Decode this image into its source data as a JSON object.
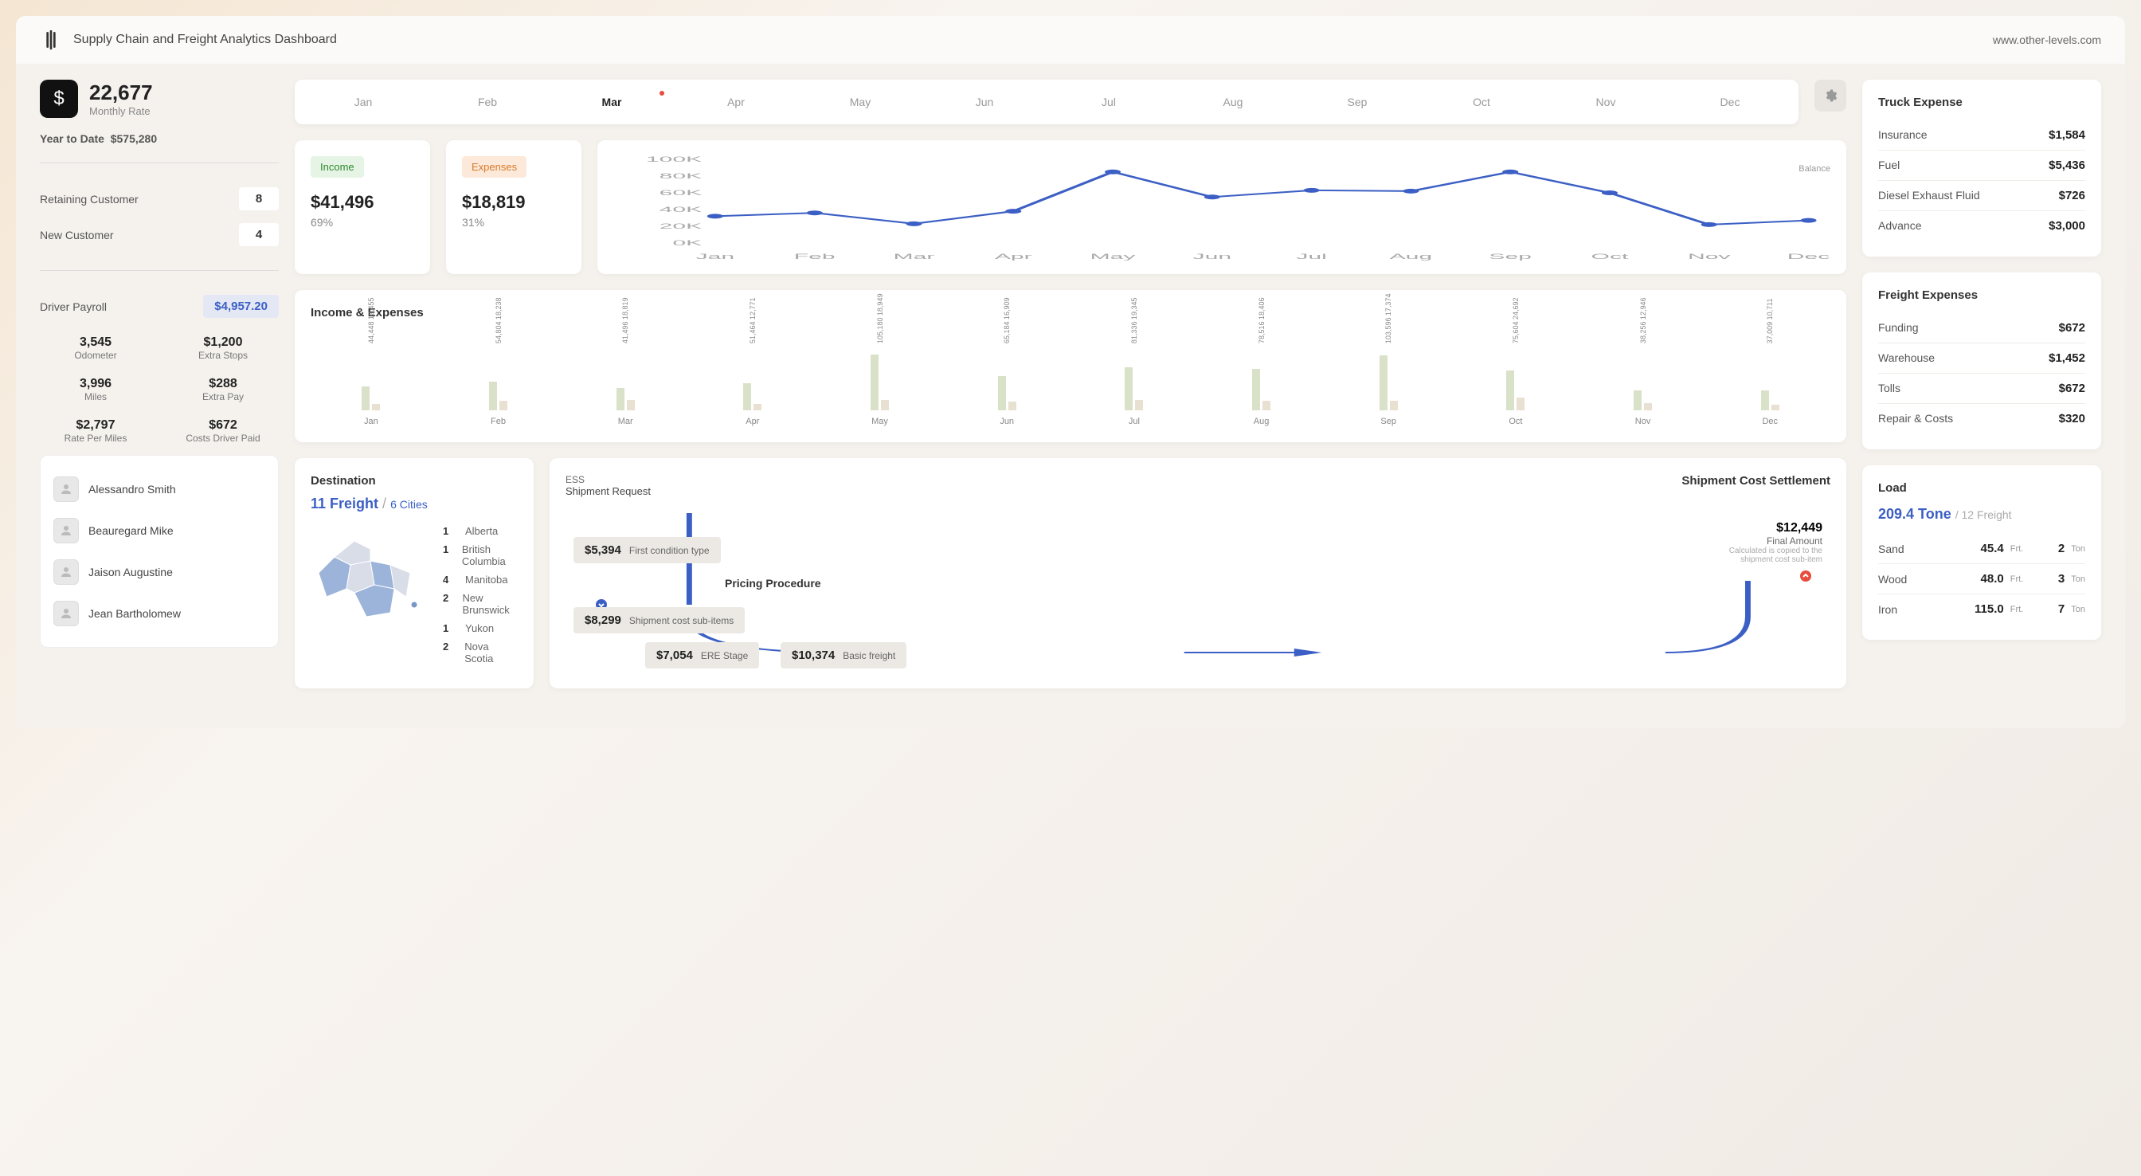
{
  "header": {
    "title": "Supply Chain and Freight Analytics Dashboard",
    "url": "www.other-levels.com"
  },
  "rate": {
    "value": "22,677",
    "label": "Monthly Rate",
    "ytd_label": "Year to Date",
    "ytd_value": "$575,280"
  },
  "customers": [
    {
      "label": "Retaining Customer",
      "value": "8"
    },
    {
      "label": "New Customer",
      "value": "4"
    }
  ],
  "payroll": {
    "label": "Driver Payroll",
    "value": "$4,957.20"
  },
  "stats": [
    {
      "v": "3,545",
      "l": "Odometer"
    },
    {
      "v": "$1,200",
      "l": "Extra Stops"
    },
    {
      "v": "3,996",
      "l": "Miles"
    },
    {
      "v": "$288",
      "l": "Extra Pay"
    },
    {
      "v": "$2,797",
      "l": "Rate Per Miles"
    },
    {
      "v": "$672",
      "l": "Costs Driver Paid"
    }
  ],
  "drivers": [
    "Alessandro Smith",
    "Beauregard Mike",
    "Jaison Augustine",
    "Jean Bartholomew"
  ],
  "months": [
    "Jan",
    "Feb",
    "Mar",
    "Apr",
    "May",
    "Jun",
    "Jul",
    "Aug",
    "Sep",
    "Oct",
    "Nov",
    "Dec"
  ],
  "active_month": "Mar",
  "income_card": {
    "badge": "Income",
    "value": "$41,496",
    "pct": "69%"
  },
  "expense_card": {
    "badge": "Expenses",
    "value": "$18,819",
    "pct": "31%"
  },
  "chart_data": {
    "type": "line",
    "title": "Balance",
    "ylabel": "",
    "xlabel": "",
    "ylim": [
      0,
      100000
    ],
    "yticks": [
      "0K",
      "20K",
      "40K",
      "60K",
      "80K",
      "100K"
    ],
    "categories": [
      "Jan",
      "Feb",
      "Mar",
      "Apr",
      "May",
      "Jun",
      "Jul",
      "Aug",
      "Sep",
      "Oct",
      "Nov",
      "Dec"
    ],
    "values": [
      32000,
      36000,
      23000,
      38000,
      85000,
      55000,
      63000,
      62000,
      85000,
      60000,
      22000,
      27000
    ]
  },
  "income_expenses": {
    "title": "Income & Expenses",
    "type": "bar",
    "categories": [
      "Jan",
      "Feb",
      "Mar",
      "Apr",
      "May",
      "Jun",
      "Jul",
      "Aug",
      "Sep",
      "Oct",
      "Nov",
      "Dec"
    ],
    "series": [
      {
        "name": "Income",
        "values": [
          44448,
          54804,
          41496,
          51464,
          105180,
          65184,
          81336,
          78516,
          103596,
          75604,
          38256,
          37009
        ]
      },
      {
        "name": "Expenses",
        "values": [
          12455,
          18238,
          18819,
          12771,
          18949,
          16909,
          19345,
          18406,
          17374,
          24692,
          12946,
          10711
        ]
      }
    ]
  },
  "destination": {
    "title": "Destination",
    "freight": "11 Freight",
    "cities": "6 Cities",
    "list": [
      {
        "n": "1",
        "name": "Alberta"
      },
      {
        "n": "1",
        "name": "British Columbia"
      },
      {
        "n": "4",
        "name": "Manitoba"
      },
      {
        "n": "2",
        "name": "New Brunswick"
      },
      {
        "n": "1",
        "name": "Yukon"
      },
      {
        "n": "2",
        "name": "Nova Scotia"
      }
    ]
  },
  "shipment": {
    "ess": "ESS",
    "req": "Shipment Request",
    "title": "Shipment Cost Settlement",
    "pricing": "Pricing Procedure",
    "boxes": [
      {
        "amt": "$5,394",
        "lbl": "First condition type"
      },
      {
        "amt": "$8,299",
        "lbl": "Shipment cost sub-items"
      },
      {
        "amt": "$7,054",
        "lbl": "ERE Stage"
      },
      {
        "amt": "$10,374",
        "lbl": "Basic freight"
      }
    ],
    "final": {
      "amt": "$12,449",
      "lbl": "Final Amount",
      "note": "Calculated is copied to the shipment cost sub-item"
    }
  },
  "truck_exp": {
    "title": "Truck Expense",
    "rows": [
      {
        "l": "Insurance",
        "v": "$1,584"
      },
      {
        "l": "Fuel",
        "v": "$5,436"
      },
      {
        "l": "Diesel Exhaust Fluid",
        "v": "$726"
      },
      {
        "l": "Advance",
        "v": "$3,000"
      }
    ]
  },
  "freight_exp": {
    "title": "Freight Expenses",
    "rows": [
      {
        "l": "Funding",
        "v": "$672"
      },
      {
        "l": "Warehouse",
        "v": "$1,452"
      },
      {
        "l": "Tolls",
        "v": "$672"
      },
      {
        "l": "Repair & Costs",
        "v": "$320"
      }
    ]
  },
  "load": {
    "title": "Load",
    "tone": "209.4 Tone",
    "freight": "12 Freight",
    "rows": [
      {
        "name": "Sand",
        "frt": "45.4",
        "ton": "2"
      },
      {
        "name": "Wood",
        "frt": "48.0",
        "ton": "3"
      },
      {
        "name": "Iron",
        "frt": "115.0",
        "ton": "7"
      }
    ],
    "frt_unit": "Frt.",
    "ton_unit": "Ton"
  }
}
